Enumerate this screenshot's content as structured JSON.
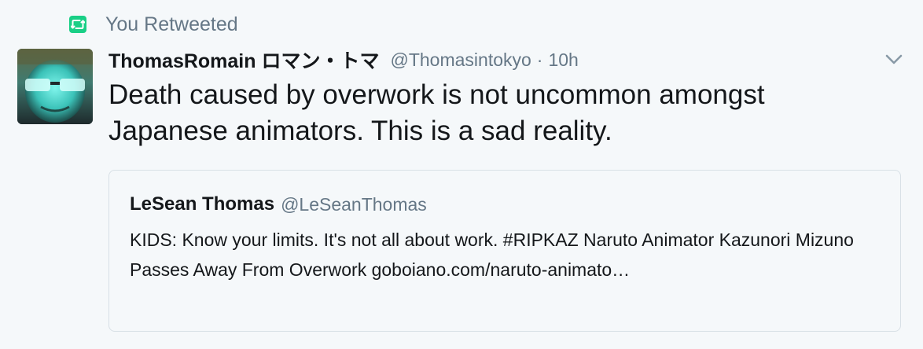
{
  "retweet_context": {
    "label": "You Retweeted",
    "icon": "retweet-icon",
    "icon_color": "#19cf86"
  },
  "tweet": {
    "avatar_icon": "avatar-image",
    "display_name": "ThomasRomain ロマン・トマ",
    "handle": "@Thomasintokyo",
    "separator": "·",
    "time": "10h",
    "menu_icon": "chevron-down-icon",
    "text": "Death caused by overwork is not uncommon amongst Japanese animators. This is a sad reality."
  },
  "quoted_tweet": {
    "display_name": "LeSean Thomas",
    "handle": "@LeSeanThomas",
    "text": "KIDS: Know your limits. It's not all about work. #RIPKAZ Naruto Animator Kazunori Mizuno Passes Away From Overwork goboiano.com/naruto-animato…"
  },
  "colors": {
    "background": "#f5f8fa",
    "text_primary": "#14171a",
    "text_secondary": "#657786",
    "card_border": "#d8e0e6"
  }
}
